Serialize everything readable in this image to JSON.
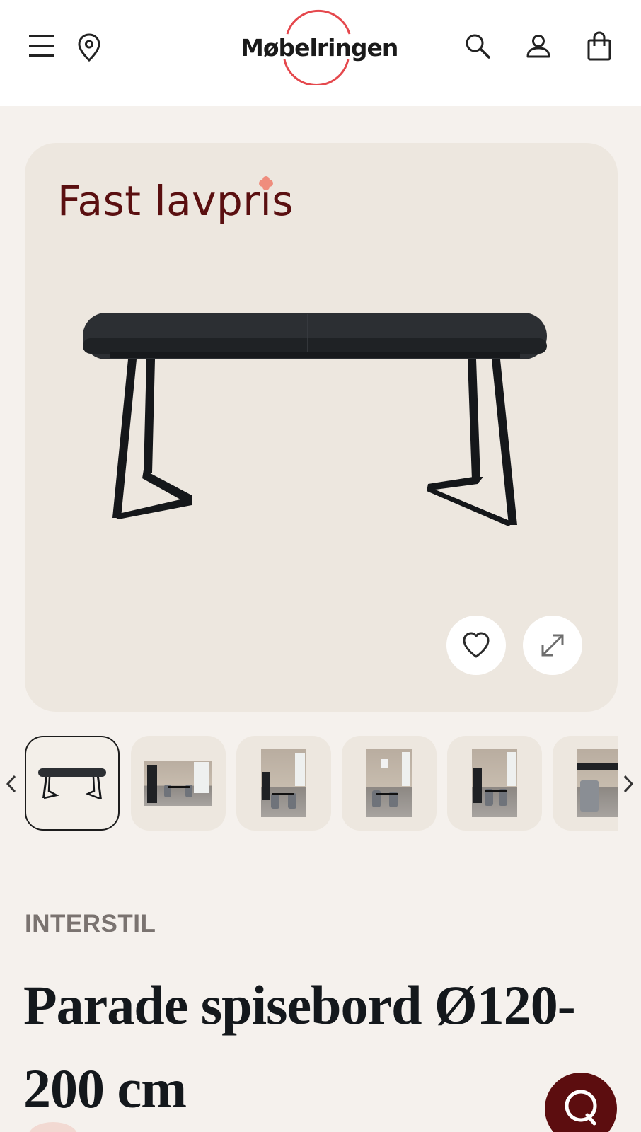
{
  "header": {
    "brand_name": "Møbelringen",
    "menu_icon": "hamburger-menu-icon",
    "store_icon": "location-pin-icon",
    "search_icon": "search-icon",
    "account_icon": "user-icon",
    "cart_icon": "shopping-bag-icon"
  },
  "hero": {
    "badge": "Fast lavpris",
    "favorite_icon": "heart-icon",
    "expand_icon": "expand-icon"
  },
  "gallery": {
    "prev_icon": "chevron-left-icon",
    "next_icon": "chevron-right-icon",
    "selected_index": 0,
    "thumbnail_count": 6
  },
  "product": {
    "brand": "INTERSTIL",
    "title": "Parade spisebord Ø120-200 cm"
  },
  "chat": {
    "icon": "chat-bubble-icon"
  },
  "colors": {
    "brand_red": "#e5484d",
    "badge_text": "#5a0f10",
    "chat_button": "#5c0d0f",
    "page_background": "#f5f1ed",
    "card_background": "#ede7df"
  }
}
